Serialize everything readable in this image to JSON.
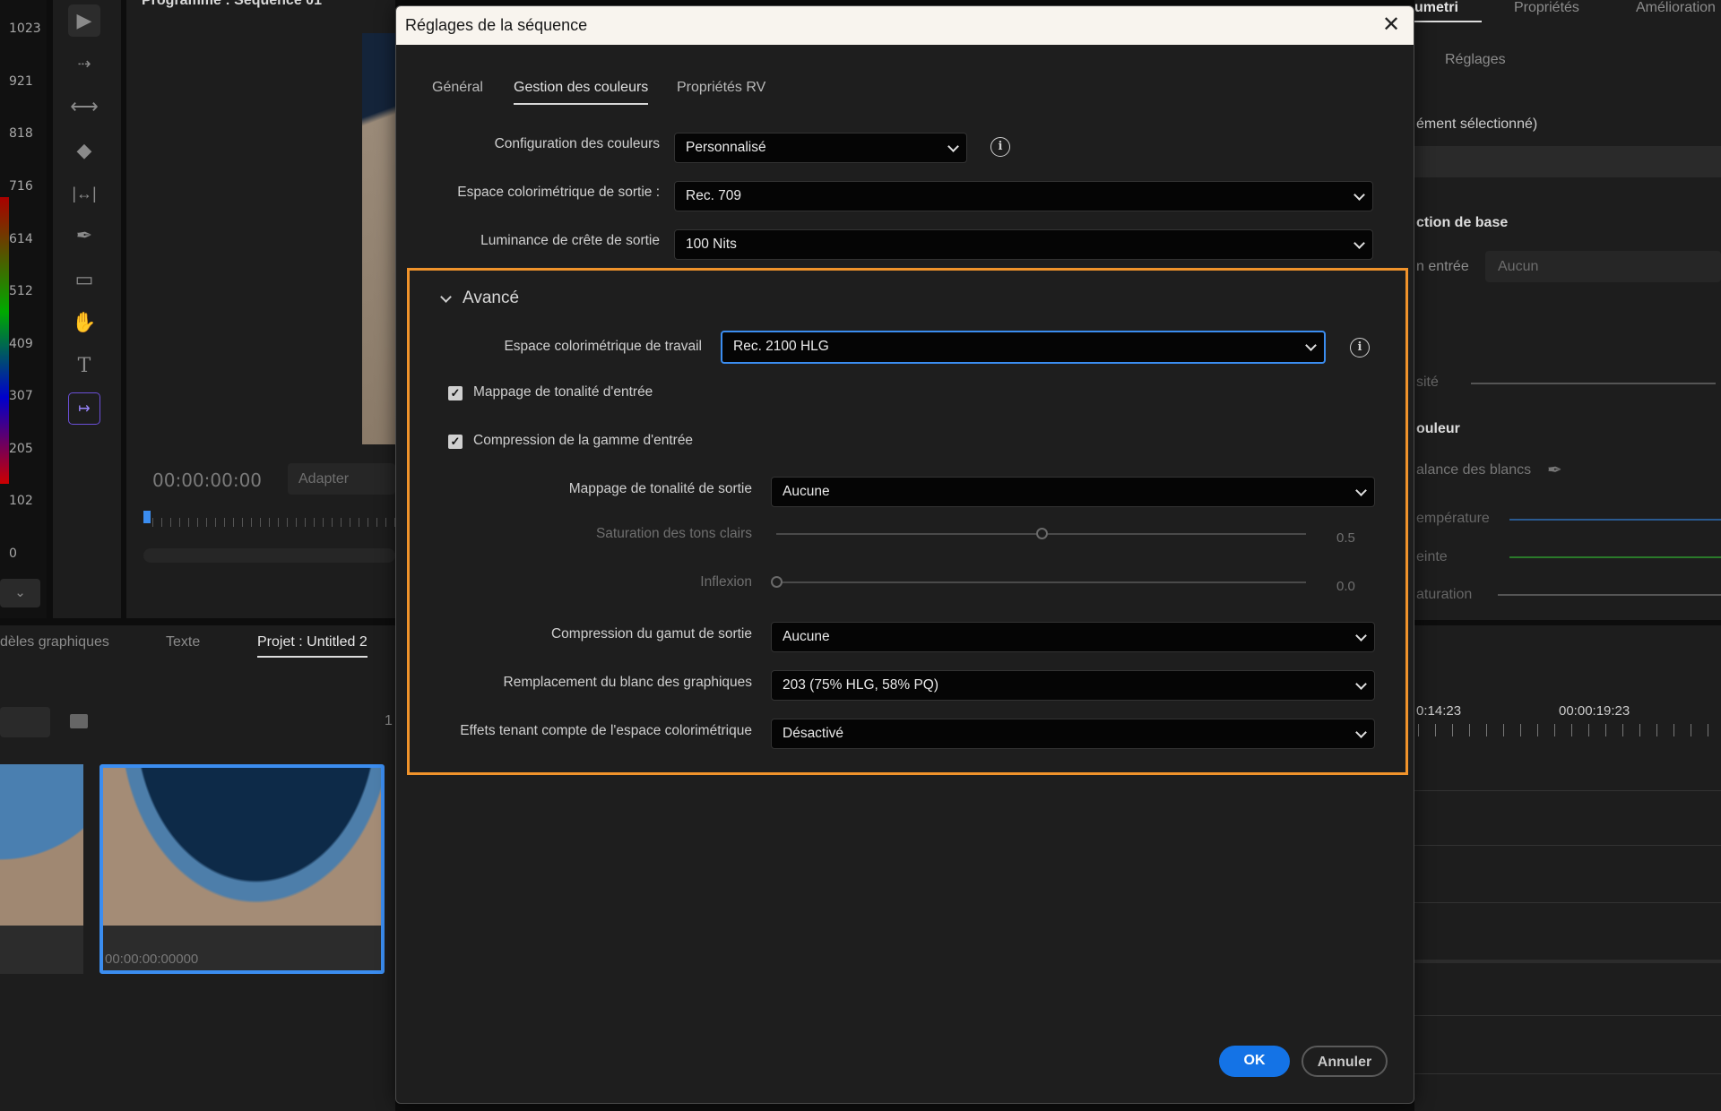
{
  "histogram": {
    "labels": [
      "1023",
      "921",
      "818",
      "716",
      "614",
      "512",
      "409",
      "307",
      "205",
      "102",
      "0"
    ]
  },
  "tools": [
    "selection-tool",
    "track-select-tool",
    "ripple-edit-tool",
    "razor-tool",
    "slip-tool",
    "pen-tool",
    "rectangle-tool",
    "hand-tool",
    "type-tool",
    "generative-extend-tool"
  ],
  "program_monitor": {
    "title": "Programme : Séquence 01",
    "timecode": "00:00:00:00",
    "fit": "Adapter"
  },
  "bottom_panel": {
    "tabs": [
      "dèles graphiques",
      "Texte",
      "Projet : Untitled 2"
    ],
    "item_count": "1",
    "thumb_timecode": "00:00:00:00000"
  },
  "right_panel": {
    "tabs": [
      "umetri",
      "Propriétés",
      "Amélioration"
    ],
    "sub_tab": "Réglages",
    "selection": "ément sélectionné)",
    "section_basic": "ction de base",
    "input_label": "n entrée",
    "input_value": "Aucun",
    "intensity": "sité",
    "color_section": "ouleur",
    "white_balance": "alance des blancs",
    "temperature": "empérature",
    "tint": "einte",
    "saturation": "aturation",
    "timecodes": [
      "0:14:23",
      "00:00:19:23"
    ]
  },
  "dialog": {
    "title": "Réglages de la séquence",
    "tabs": [
      "Général",
      "Gestion des couleurs",
      "Propriétés RV"
    ],
    "active_tab": "Gestion des couleurs",
    "color_config": {
      "label": "Configuration des couleurs",
      "value": "Personnalisé"
    },
    "output_space": {
      "label": "Espace colorimétrique de sortie :",
      "value": "Rec. 709"
    },
    "peak_luminance": {
      "label": "Luminance de crête de sortie",
      "value": "100 Nits"
    },
    "advanced": {
      "title": "Avancé",
      "working_space": {
        "label": "Espace colorimétrique de travail",
        "value": "Rec. 2100 HLG"
      },
      "input_tone_mapping": {
        "label": "Mappage de tonalité d'entrée",
        "checked": true
      },
      "input_gamut_compression": {
        "label": "Compression de la gamme d'entrée",
        "checked": true
      },
      "output_tone_mapping": {
        "label": "Mappage de tonalité de sortie",
        "value": "Aucune"
      },
      "highlight_saturation": {
        "label": "Saturation des tons clairs",
        "value": "0.5",
        "fraction": 0.5
      },
      "knee": {
        "label": "Inflexion",
        "value": "0.0",
        "fraction": 0.0
      },
      "output_gamut_compression": {
        "label": "Compression du gamut de sortie",
        "value": "Aucune"
      },
      "graphics_white": {
        "label": "Remplacement du blanc des graphiques",
        "value": "203 (75% HLG, 58% PQ)"
      },
      "color_space_aware_effects": {
        "label": "Effets tenant compte de l'espace colorimétrique",
        "value": "Désactivé"
      }
    },
    "ok": "OK",
    "cancel": "Annuler"
  },
  "colors": {
    "accent": "#1473e6",
    "highlight_box": "#f0932b",
    "focus": "#3b8df0"
  }
}
